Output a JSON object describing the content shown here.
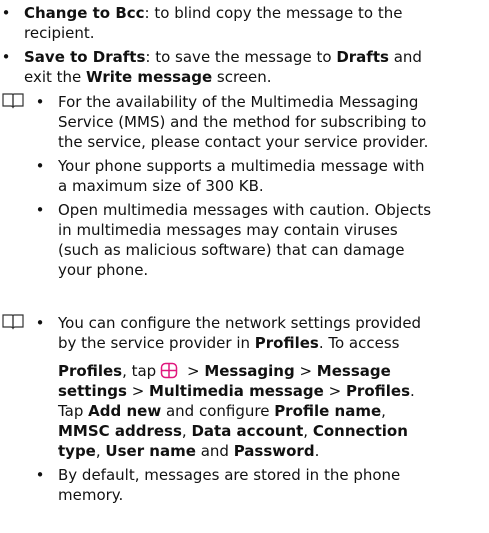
{
  "top_list": [
    {
      "term": "Change to Bcc",
      "text": ": to blind copy the message to the",
      "text_cont": "recipient."
    },
    {
      "term": "Save to Drafts",
      "text_a": ": to save the message to ",
      "bold_a": "Drafts",
      "text_b": " and",
      "cont_a": "exit the ",
      "cont_bold": "Write message",
      "cont_b": " screen."
    }
  ],
  "note1": [
    [
      "For the availability of the Multimedia Messaging",
      "Service (MMS) and the method for subscribing to",
      "the service, please contact your service provider."
    ],
    [
      "Your phone supports a multimedia message with",
      "a maximum size of 300 KB."
    ],
    [
      "Open multimedia messages with caution. Objects",
      "in multimedia messages may contain viruses",
      "(such as malicious software) that can damage",
      "your phone."
    ]
  ],
  "note2": {
    "line1": "You can configure the network settings provided",
    "line2_a": "by the service provider in ",
    "line2_b": ". To access",
    "profiles": "Profiles",
    "comma_tap": ", tap",
    "gt": " > ",
    "messaging": "Messaging",
    "message": "Message",
    "settings": "settings",
    "multimedia_message": "Multimedia message",
    "period": ".",
    "tap": "Tap ",
    "add_new": "Add new",
    "and_configure": " and configure ",
    "profile_name": "Profile name",
    "comma": ", ",
    "mmsc_address": "MMSC address",
    "data_account": "Data account",
    "connection": "Connection",
    "type": "type",
    "user_name": "User name",
    "and": " and ",
    "password": "Password",
    "item2_line1": "By default, messages are stored in the phone",
    "item2_line2": "memory."
  }
}
